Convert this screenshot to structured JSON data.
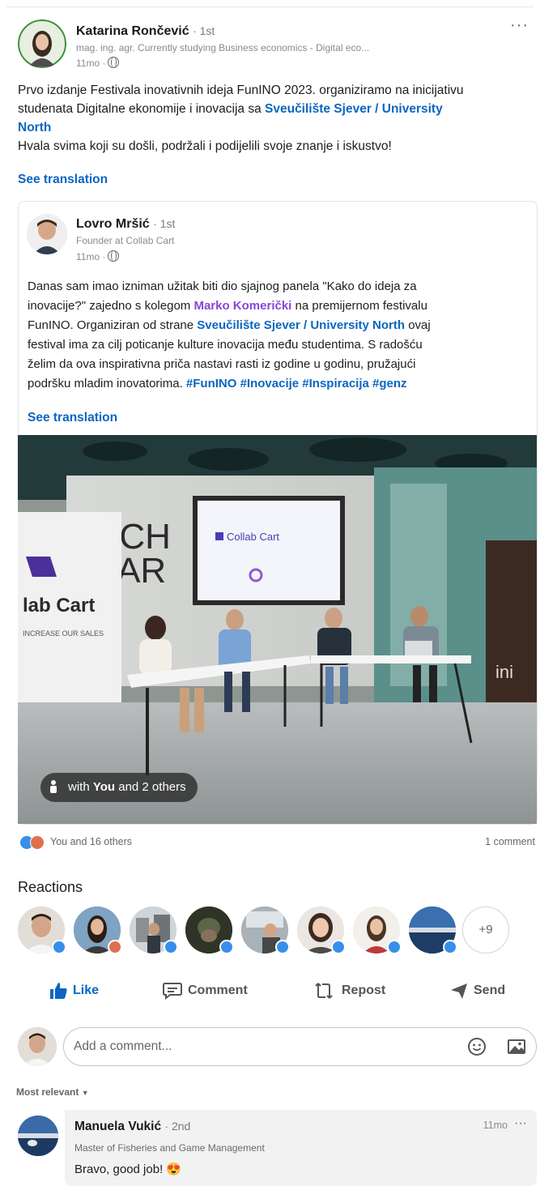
{
  "post": {
    "author_name": "Katarina Rončević",
    "author_degree": "· 1st",
    "author_headline": "mag. ing. agr. Currently studying Business economics - Digital eco...",
    "time": "11mo ·",
    "more_label": "···",
    "text_line1": "Prvo izdanje Festivala inovativnih ideja FunINO 2023. organiziramo na inicijativu",
    "text_line2_pre": "studenata Digitalne ekonomije i inovacija sa ",
    "text_line2_link": "Sveučilište Sjever / University",
    "text_line3_link": "North",
    "text_line4": "Hvala svima koji su došli, podržali i podijelili svoje znanje i iskustvo!",
    "see_translation": "See translation"
  },
  "shared": {
    "author_name": "Lovro Mršić",
    "author_degree": "· 1st",
    "author_headline": "Founder at Collab Cart",
    "time": "11mo ·",
    "line1": "Danas sam imao izniman užitak biti dio sjajnog panela \"Kako do ideja za",
    "line2_pre": "inovacije?\" zajedno s kolegom ",
    "line2_mention": "Marko Komerički",
    "line2_post": " na premijernom festivalu",
    "line3_pre": "FunINO. Organiziran od strane ",
    "line3_link": "Sveučilište Sjever / University North",
    "line3_post": " ovaj",
    "line4": "festival ima za cilj poticanje kulture inovacija među studentima. S radošću",
    "line5": "želim da ova inspirativna priča nastavi rasti iz godine u godinu, pružajući",
    "line6_pre": "podršku mladim inovatorima. ",
    "line6_tags": "#FunINO #Inovacije #Inspiracija #genz",
    "see_translation": "See translation",
    "photo": {
      "screen_logo": "Collab Cart",
      "banner_left": "lab Cart",
      "banner_left_sub": "INCREASE OUR SALES",
      "wall_text_1": "ECH",
      "wall_text_2": "PAR",
      "banner_right": "ini",
      "tag_with": "with ",
      "tag_you": "You",
      "tag_rest": " and 2 others"
    }
  },
  "social": {
    "reactions_summary": "You and 16 others",
    "comments_count": "1 comment",
    "reactions_title": "Reactions",
    "more_reactors": "+9"
  },
  "actions": {
    "like": "Like",
    "comment": "Comment",
    "repost": "Repost",
    "send": "Send"
  },
  "comment_input": {
    "placeholder": "Add a comment..."
  },
  "sort_label": "Most relevant",
  "comment": {
    "author_name": "Manuela Vukić",
    "author_degree": "· 2nd",
    "headline": "Master of Fisheries and Game Management",
    "time": "11mo",
    "more_label": "···",
    "text": "Bravo, good job! 😍"
  },
  "colors": {
    "link": "#0a66c2",
    "mention": "#8a44d8",
    "like_blue": "#378fe9",
    "love_red": "#df704d"
  }
}
